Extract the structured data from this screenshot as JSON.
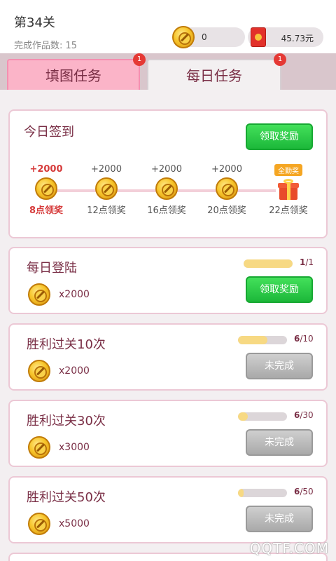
{
  "header": {
    "level_title": "第34关",
    "works_count": "完成作品数: 15",
    "coins": "0",
    "cash": "45.73元"
  },
  "tabs": [
    {
      "label": "填图任务",
      "badge": "1"
    },
    {
      "label": "每日任务",
      "badge": "1"
    }
  ],
  "checkin": {
    "title": "今日签到",
    "button": "领取奖励",
    "bonus_tag": "全勤奖",
    "steps": [
      {
        "bonus": "+2000",
        "label": "8点领奖"
      },
      {
        "bonus": "+2000",
        "label": "12点领奖"
      },
      {
        "bonus": "+2000",
        "label": "16点领奖"
      },
      {
        "bonus": "+2000",
        "label": "20点领奖"
      },
      {
        "bonus": "",
        "label": "22点领奖"
      }
    ]
  },
  "tasks": [
    {
      "title": "每日登陆",
      "reward": "x2000",
      "progress_current": "1",
      "progress_total": "/1",
      "progress_fraction": 1.0,
      "button": "领取奖励"
    },
    {
      "title": "胜利过关10次",
      "reward": "x2000",
      "progress_current": "6",
      "progress_total": "/10",
      "progress_fraction": 0.6,
      "button": "未完成"
    },
    {
      "title": "胜利过关30次",
      "reward": "x3000",
      "progress_current": "6",
      "progress_total": "/30",
      "progress_fraction": 0.2,
      "button": "未完成"
    },
    {
      "title": "胜利过关50次",
      "reward": "x5000",
      "progress_current": "6",
      "progress_total": "/50",
      "progress_fraction": 0.12,
      "button": "未完成"
    }
  ],
  "watermark": "QQTF.COM",
  "colors": {
    "accent": "#7a2f46",
    "tab_active": "#fbb4c8",
    "button_green": "#1cb83a",
    "button_gray": "#a9a9a9"
  }
}
